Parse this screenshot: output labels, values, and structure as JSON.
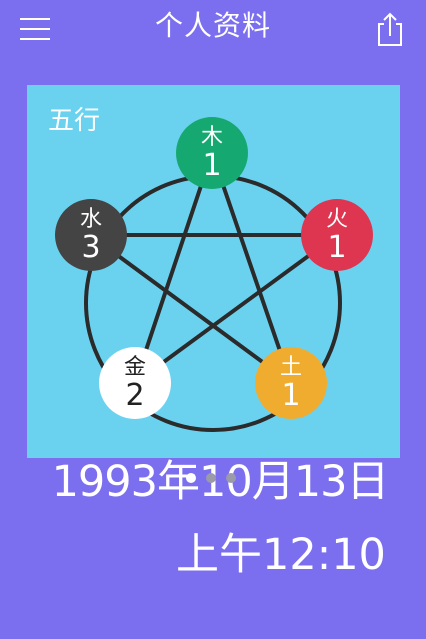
{
  "header": {
    "title": "个人资料",
    "menu_icon": "hamburger-menu-icon",
    "share_icon": "share-icon"
  },
  "elements_panel": {
    "label": "五行",
    "background": "#6ad2ef",
    "nodes": [
      {
        "key": "wood",
        "char": "木",
        "count": "1",
        "color": "#16a871",
        "text_color": "#ffffff"
      },
      {
        "key": "fire",
        "char": "火",
        "count": "1",
        "color": "#de3550",
        "text_color": "#ffffff"
      },
      {
        "key": "earth",
        "char": "土",
        "count": "1",
        "color": "#f0ac2e",
        "text_color": "#ffffff"
      },
      {
        "key": "metal",
        "char": "金",
        "count": "2",
        "color": "#ffffff",
        "text_color": "#222222"
      },
      {
        "key": "water",
        "char": "水",
        "count": "3",
        "color": "#444444",
        "text_color": "#ffffff"
      }
    ]
  },
  "birth": {
    "date": "1993年10月13日",
    "time": "上午12:10"
  },
  "colors": {
    "background": "#7b6ff0",
    "star_line": "#2b2b2b"
  }
}
